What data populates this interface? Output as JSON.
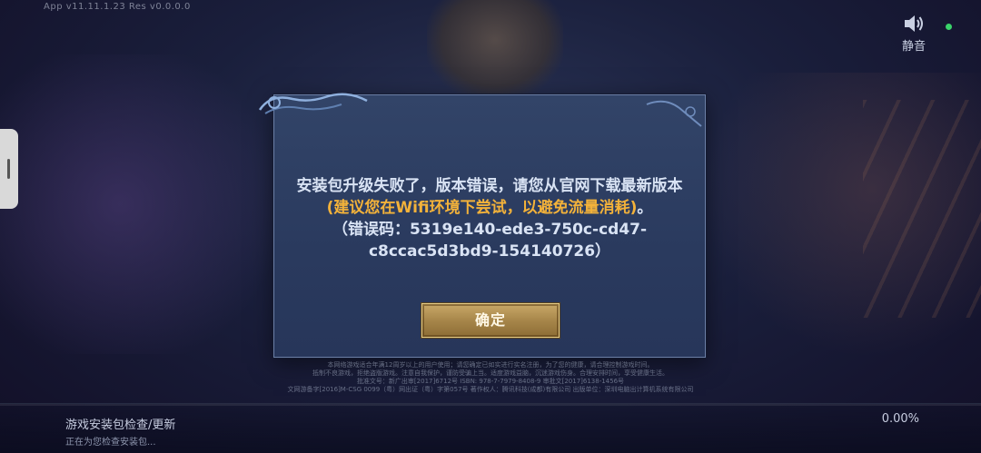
{
  "app": {
    "version_text": "App v11.11.1.23 Res v0.0.0.0"
  },
  "header": {
    "mute_icon": "speaker-icon",
    "mute_label": "静音",
    "status_color": "#3ad36a"
  },
  "dialog": {
    "message_prefix": "安装包升级失败了，版本错误，请您从官网下载最新版本",
    "message_highlight": "(建议您在Wifi环境下尝试，以避免流量消耗)",
    "message_suffix": "。",
    "error_code_line": "（错误码：5319e140-ede3-750c-cd47-c8ccac5d3bd9-154140726）",
    "confirm_label": "确定",
    "highlight_color": "#f3b23a"
  },
  "legal": {
    "lines": [
      "本网络游戏适合年满12周岁以上的用户使用；请您确定已如实进行实名注册，为了您的健康，请合理控制游戏时间。",
      "抵制不良游戏，拒绝盗版游戏。注意自我保护，谨防受骗上当。适度游戏益脑，沉迷游戏伤身。合理安排时间，享受健康生活。",
      "批准文号：新广出审[2017]6712号 ISBN: 978-7-7979-8408-9 审批文[2017]6138-1456号",
      "文网游备字[2016]M-CSG 0099（粤）网出证（粤）字第057号 著作权人：腾讯科技(成都)有限公司 出版单位：深圳电脑出计算机系统有限公司"
    ]
  },
  "bottom": {
    "title": "游戏安装包检查/更新",
    "subtitle": "正在为您检查安装包...",
    "progress_text": "0.00%",
    "progress_value": 0
  }
}
